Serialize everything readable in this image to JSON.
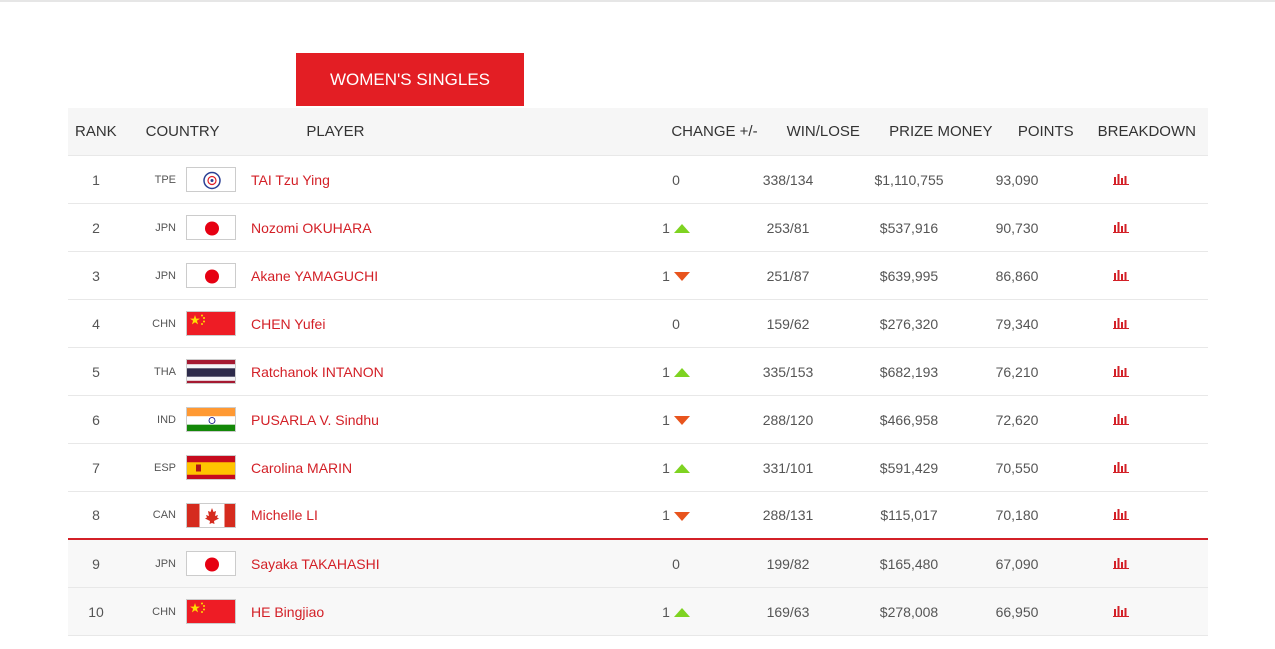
{
  "tab": {
    "label": "WOMEN'S SINGLES"
  },
  "colors": {
    "accent": "#e31e24",
    "up": "#7ed321",
    "down": "#e8541d"
  },
  "headers": {
    "rank": "RANK",
    "country": "COUNTRY",
    "player": "PLAYER",
    "change": "CHANGE +/-",
    "winlose": "WIN/LOSE",
    "prize": "PRIZE MONEY",
    "points": "POINTS",
    "breakdown": "BREAKDOWN"
  },
  "rows": [
    {
      "rank": "1",
      "code": "TPE",
      "flag": "tpe-flag",
      "player": "TAI Tzu Ying",
      "change": "0",
      "dir": "none",
      "wl": "338/134",
      "prize": "$1,110,755",
      "points": "93,090"
    },
    {
      "rank": "2",
      "code": "JPN",
      "flag": "jpn-flag",
      "player": "Nozomi OKUHARA",
      "change": "1",
      "dir": "up",
      "wl": "253/81",
      "prize": "$537,916",
      "points": "90,730"
    },
    {
      "rank": "3",
      "code": "JPN",
      "flag": "jpn-flag",
      "player": "Akane YAMAGUCHI",
      "change": "1",
      "dir": "down",
      "wl": "251/87",
      "prize": "$639,995",
      "points": "86,860"
    },
    {
      "rank": "4",
      "code": "CHN",
      "flag": "chn-flag",
      "player": "CHEN Yufei",
      "change": "0",
      "dir": "none",
      "wl": "159/62",
      "prize": "$276,320",
      "points": "79,340"
    },
    {
      "rank": "5",
      "code": "THA",
      "flag": "tha-flag",
      "player": "Ratchanok INTANON",
      "change": "1",
      "dir": "up",
      "wl": "335/153",
      "prize": "$682,193",
      "points": "76,210"
    },
    {
      "rank": "6",
      "code": "IND",
      "flag": "ind-flag",
      "player": "PUSARLA V. Sindhu",
      "change": "1",
      "dir": "down",
      "wl": "288/120",
      "prize": "$466,958",
      "points": "72,620"
    },
    {
      "rank": "7",
      "code": "ESP",
      "flag": "esp-flag",
      "player": "Carolina MARIN",
      "change": "1",
      "dir": "up",
      "wl": "331/101",
      "prize": "$591,429",
      "points": "70,550"
    },
    {
      "rank": "8",
      "code": "CAN",
      "flag": "can-flag",
      "player": "Michelle LI",
      "change": "1",
      "dir": "down",
      "wl": "288/131",
      "prize": "$115,017",
      "points": "70,180"
    },
    {
      "rank": "9",
      "code": "JPN",
      "flag": "jpn-flag",
      "player": "Sayaka TAKAHASHI",
      "change": "0",
      "dir": "none",
      "wl": "199/82",
      "prize": "$165,480",
      "points": "67,090"
    },
    {
      "rank": "10",
      "code": "CHN",
      "flag": "chn-flag",
      "player": "HE Bingjiao",
      "change": "1",
      "dir": "up",
      "wl": "169/63",
      "prize": "$278,008",
      "points": "66,950"
    }
  ]
}
